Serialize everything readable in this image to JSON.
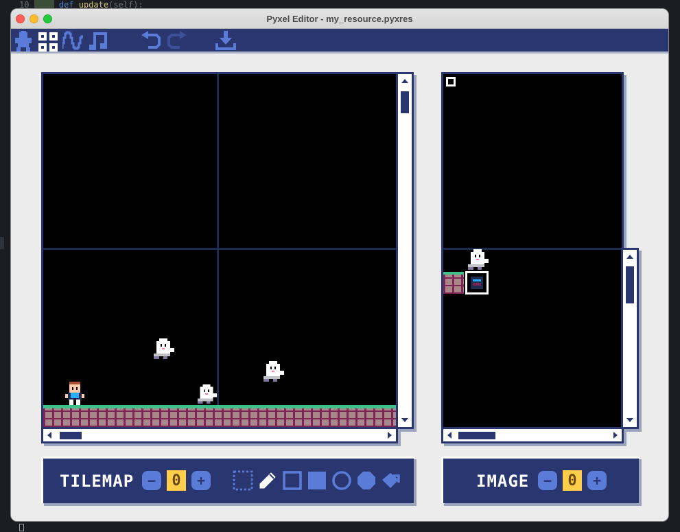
{
  "background": {
    "line_number": "10",
    "code_keyword": "def",
    "code_function": "update",
    "code_rest": "(self):"
  },
  "window": {
    "title": "Pyxel Editor - my_resource.pyxres"
  },
  "toolbar": {
    "items": [
      {
        "name": "image-editor-icon"
      },
      {
        "name": "tilemap-editor-icon"
      },
      {
        "name": "sound-editor-icon"
      },
      {
        "name": "music-editor-icon"
      },
      {
        "name": "undo-icon"
      },
      {
        "name": "redo-icon"
      },
      {
        "name": "save-icon"
      }
    ]
  },
  "tilemap_panel": {
    "label": "TILEMAP",
    "number": "0",
    "minus": "−",
    "plus": "+",
    "tools": [
      "select-tool-icon",
      "pencil-tool-icon",
      "rectangle-tool-icon",
      "filled-rectangle-tool-icon",
      "circle-tool-icon",
      "filled-circle-tool-icon",
      "bucket-tool-icon"
    ]
  },
  "image_panel": {
    "label": "IMAGE",
    "number": "0",
    "minus": "−",
    "plus": "+"
  },
  "colors": {
    "navy": "#29366f",
    "grid": "#1d2b53",
    "accent_blue": "#5b7bd8",
    "yellow": "#ffcd4a",
    "grass": "#3fbf8a",
    "brick": "#7e2553"
  }
}
